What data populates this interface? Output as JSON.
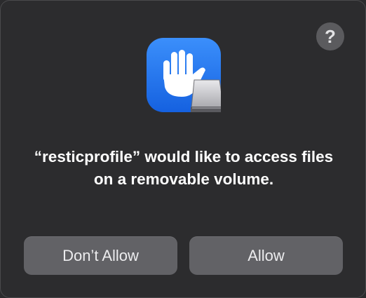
{
  "dialog": {
    "help_label": "?",
    "icon_name": "privacy-hand-removable-drive-icon",
    "message": "“resticprofile” would like to access files on a removable volume.",
    "buttons": {
      "dont_allow": "Don’t Allow",
      "allow": "Allow"
    }
  },
  "colors": {
    "dialog_background": "#2c2c2e",
    "button_background": "#626266",
    "help_button_background": "#5b5b5e",
    "icon_blue": "#1f72e8"
  }
}
